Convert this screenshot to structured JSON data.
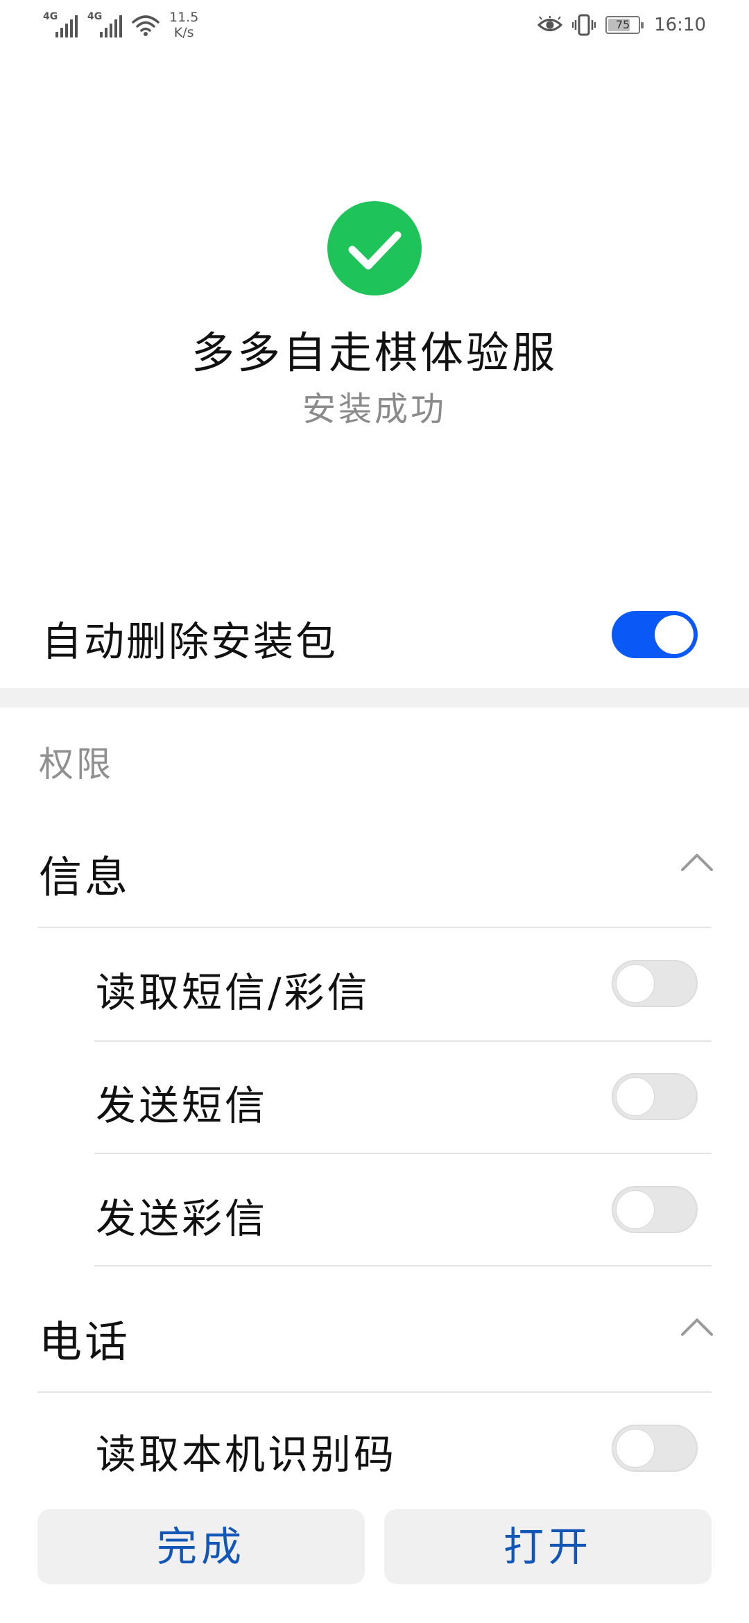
{
  "status_bar": {
    "signal1_label": "4G",
    "signal2_label": "4G",
    "net_speed_value": "11.5",
    "net_speed_unit": "K/s",
    "battery_percent": "75",
    "battery_level": 0.75,
    "time": "16:10",
    "icons": [
      "signal-icon",
      "signal-icon",
      "wifi-icon",
      "eye-icon",
      "vibrate-icon",
      "battery-icon"
    ]
  },
  "header": {
    "icon": "check-circle-icon",
    "icon_color": "#1ec45a",
    "app_name": "多多自走棋体验服",
    "status": "安装成功"
  },
  "auto_delete": {
    "label": "自动删除安装包",
    "enabled": true
  },
  "permissions": {
    "title": "权限",
    "groups": [
      {
        "label": "信息",
        "expanded": true,
        "items": [
          {
            "label": "读取短信/彩信",
            "enabled": false
          },
          {
            "label": "发送短信",
            "enabled": false
          },
          {
            "label": "发送彩信",
            "enabled": false
          }
        ]
      },
      {
        "label": "电话",
        "expanded": true,
        "items": [
          {
            "label": "读取本机识别码",
            "enabled": false
          }
        ]
      }
    ]
  },
  "buttons": {
    "done": "完成",
    "open": "打开"
  },
  "colors": {
    "accent": "#0a59f7",
    "button_text": "#1257b8",
    "success": "#1ec45a"
  }
}
